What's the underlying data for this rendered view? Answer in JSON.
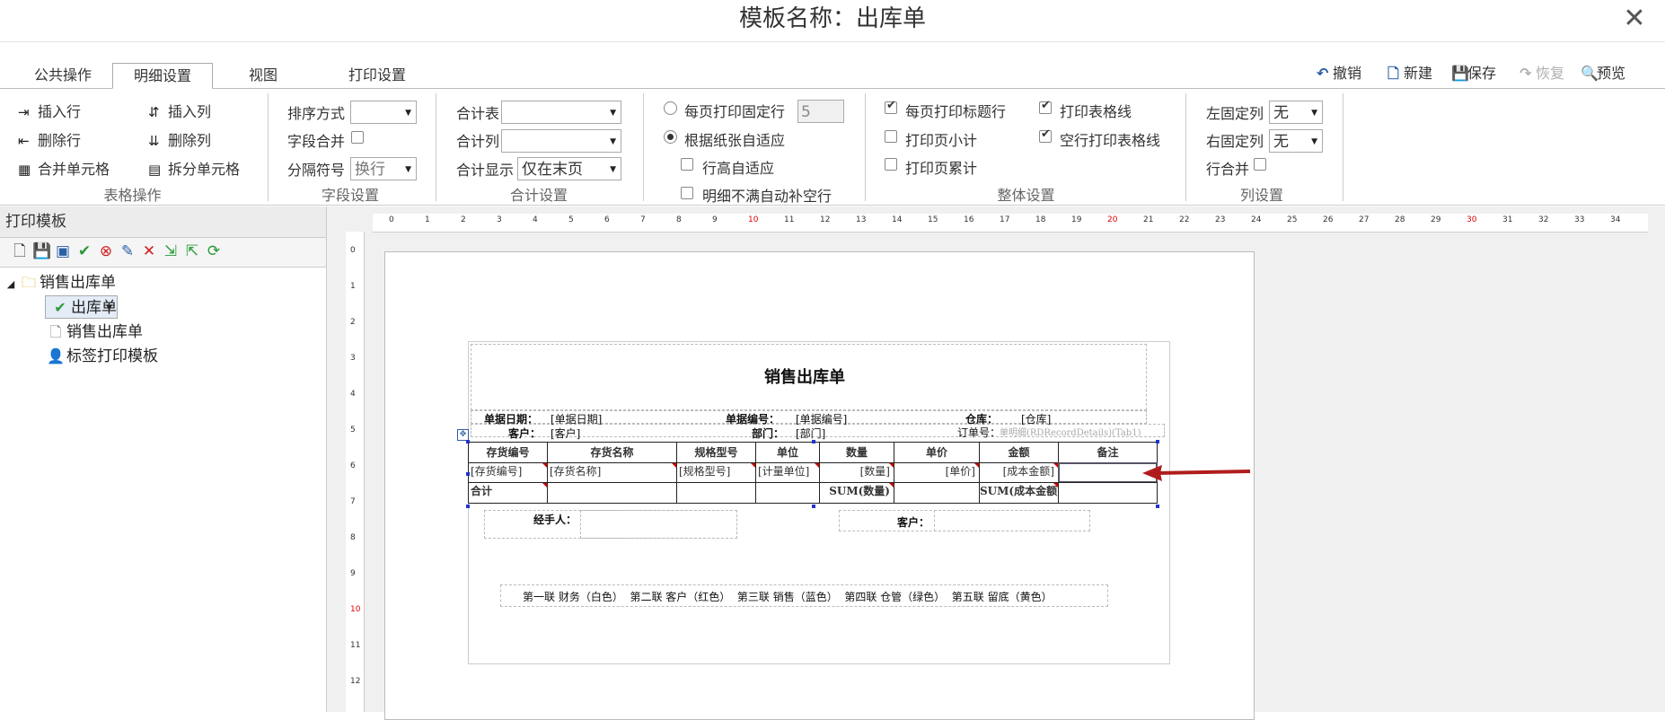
{
  "window": {
    "title": "模板名称：出库单",
    "close_symbol": "✕"
  },
  "tabs": [
    {
      "label": "公共操作",
      "active": false
    },
    {
      "label": "明细设置",
      "active": true
    },
    {
      "label": "视图",
      "active": false
    },
    {
      "label": "打印设置",
      "active": false
    }
  ],
  "toolbar": {
    "undo": "撤销",
    "new": "新建",
    "save": "保存",
    "redo": "恢复",
    "preview": "预览"
  },
  "ribbon": {
    "table_ops": {
      "group_label": "表格操作",
      "insert_row": "插入行",
      "insert_col": "插入列",
      "delete_row": "删除行",
      "delete_col": "删除列",
      "merge_cells": "合并单元格",
      "split_cells": "拆分单元格"
    },
    "field_settings": {
      "group_label": "字段设置",
      "sort_label": "排序方式",
      "sort_value": "",
      "field_merge_label": "字段合并",
      "separator_label": "分隔符号",
      "separator_value": "换行"
    },
    "total_settings": {
      "group_label": "合计设置",
      "total_table_label": "合计表",
      "total_table_value": "",
      "total_col_label": "合计列",
      "total_col_value": "",
      "total_display_label": "合计显示",
      "total_display_value": "仅在末页"
    },
    "page_settings": {
      "fixed_rows_label": "每页打印固定行",
      "fixed_rows_value": "5",
      "auto_fit_label": "根据纸张自适应",
      "row_height_auto_label": "行高自适应",
      "fill_empty_rows_label": "明细不满自动补空行"
    },
    "overall_settings": {
      "group_label": "整体设置",
      "print_title_each_page": "每页打印标题行",
      "print_page_subtotal": "打印页小计",
      "print_page_cumulative": "打印页累计",
      "print_grid_lines": "打印表格线",
      "print_empty_row_lines": "空行打印表格线"
    },
    "column_settings": {
      "group_label": "列设置",
      "left_fixed_label": "左固定列",
      "left_fixed_value": "无",
      "right_fixed_label": "右固定列",
      "right_fixed_value": "无",
      "row_merge_label": "行合并"
    }
  },
  "left_panel": {
    "header": "打印模板",
    "tree_root": "销售出库单",
    "tree_items": [
      "出库单",
      "销售出库单",
      "标签打印模板"
    ]
  },
  "ruler": {
    "h_ticks": [
      "0",
      "1",
      "2",
      "3",
      "4",
      "5",
      "6",
      "7",
      "8",
      "9",
      "10",
      "11",
      "12",
      "13",
      "14",
      "15",
      "16",
      "17",
      "18",
      "19",
      "20",
      "21",
      "22",
      "23",
      "24",
      "25",
      "26",
      "27",
      "28",
      "29",
      "30",
      "31",
      "32",
      "33",
      "34"
    ],
    "v_ticks": [
      "0",
      "1",
      "2",
      "3",
      "4",
      "5",
      "6",
      "7",
      "8",
      "9",
      "10",
      "11",
      "12"
    ]
  },
  "template": {
    "doc_title": "销售出库单",
    "header_fields": {
      "date_label": "单据日期：",
      "date_value": "[单据日期]",
      "number_label": "单据编号：",
      "number_value": "[单据编号]",
      "warehouse_label": "仓库：",
      "warehouse_value": "[仓库]",
      "customer_label": "客户：",
      "customer_value": "[客户]",
      "dept_label": "部门：",
      "dept_value": "[部门]",
      "order_label": "订单号：",
      "order_value": "单明细(RDRecordDetails)(Tab1)"
    },
    "columns": [
      "存货编号",
      "存货名称",
      "规格型号",
      "单位",
      "数量",
      "单价",
      "金额",
      "备注"
    ],
    "detail_row": [
      "[存货编号]",
      "[存货名称]",
      "[规格型号]",
      "[计量单位]",
      "[数量]",
      "[单价]",
      "[成本金额]",
      ""
    ],
    "total_row": [
      "合计",
      "",
      "",
      "",
      "SUM(数量)",
      "",
      "SUM(成本金额)",
      ""
    ],
    "footer": {
      "handler_label": "经手人：",
      "customer_label": "客户："
    },
    "copies_note": "第一联 财务（白色）  第二联 客户（红色）  第三联 销售（蓝色）  第四联 仓管（绿色）  第五联 留底（黄色）"
  },
  "colors": {
    "arrow": "#b01c1c",
    "ruler_red": "#e00000",
    "selection_handle": "#2233cc"
  }
}
